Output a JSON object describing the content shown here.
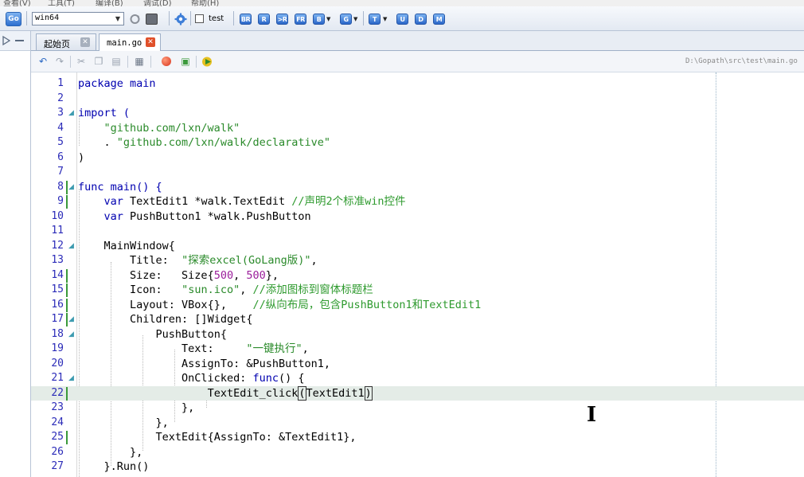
{
  "menubar": {
    "items": [
      "查看(V)",
      "工具(T)",
      "编译(B)",
      "调试(D)",
      "帮助(H)"
    ]
  },
  "toolbar": {
    "go_label": "Go",
    "target_select": "win64",
    "test_checkbox": {
      "label": "test",
      "checked": false
    },
    "buttons": [
      {
        "label": "BR"
      },
      {
        "label": "R"
      },
      {
        "label": ">R"
      },
      {
        "label": "FR"
      },
      {
        "label": "B",
        "dropdown": true
      },
      {
        "label": "G",
        "dropdown": true
      },
      {
        "label": "T",
        "dropdown": true
      },
      {
        "label": "U"
      },
      {
        "label": "D"
      },
      {
        "label": "M"
      }
    ]
  },
  "tabs": [
    {
      "label": "起始页",
      "active": false
    },
    {
      "label": "main.go",
      "active": true
    }
  ],
  "editor": {
    "file_path": "D:\\Gopath\\src\\test\\main.go",
    "current_line": 22,
    "lines": [
      {
        "n": "1"
      },
      {
        "n": "2"
      },
      {
        "n": "3"
      },
      {
        "n": "4"
      },
      {
        "n": "5"
      },
      {
        "n": "6"
      },
      {
        "n": "7"
      },
      {
        "n": "8"
      },
      {
        "n": "9"
      },
      {
        "n": "10"
      },
      {
        "n": "11"
      },
      {
        "n": "12"
      },
      {
        "n": "13"
      },
      {
        "n": "14"
      },
      {
        "n": "15"
      },
      {
        "n": "16"
      },
      {
        "n": "17"
      },
      {
        "n": "18"
      },
      {
        "n": "19"
      },
      {
        "n": "20"
      },
      {
        "n": "21"
      },
      {
        "n": "22"
      },
      {
        "n": "23"
      },
      {
        "n": "24"
      },
      {
        "n": "25"
      },
      {
        "n": "26"
      },
      {
        "n": "27"
      }
    ],
    "code": {
      "l1": "package main",
      "l3": "import (",
      "l4": "\"github.com/lxn/walk\"",
      "l5": "\"github.com/lxn/walk/declarative\"",
      "l7": ")",
      "l8": "func main() {",
      "l9_kw": "var",
      "l9_rest": "TextEdit1 *walk.TextEdit ",
      "l9_cmt": "//声明2个标准win控件",
      "l10_kw": "var",
      "l10_rest": "PushButton1 *walk.PushButton",
      "l12": "MainWindow{",
      "l13_key": "Title:  ",
      "l13_str": "\"探索excel(GoLang版)\"",
      "l14_key": "Size:   Size{",
      "l14_a": "500",
      "l14_b": "500",
      "l15_key": "Icon:   ",
      "l15_str": "\"sun.ico\"",
      "l15_cmt": "//添加图标到窗体标题栏",
      "l16_key": "Layout: VBox{},    ",
      "l16_cmt": "//纵向布局，包含PushButton1和TextEdit1",
      "l17": "Children: []Widget{",
      "l18": "PushButton{",
      "l19_key": "Text:     ",
      "l19_str": "\"一键执行\"",
      "l20": "AssignTo: &PushButton1,",
      "l21_key": "OnClicked: ",
      "l21_kw": "func",
      "l21_rest": "() {",
      "l22_a": "TextEdit_click",
      "l22_b": "TextEdit1",
      "l23": "},",
      "l24": "},",
      "l25": "TextEdit{AssignTo: &TextEdit1},",
      "l26": "},",
      "l27": "}.Run()"
    }
  },
  "colors": {
    "keyword": "#0000b0",
    "string": "#2a8a2a",
    "comment": "#2e9a2e",
    "number": "#9b1e9b",
    "line_number": "#2b2bb8",
    "change_marker": "#3a9a3a",
    "current_line_bg": "#e4ece7"
  }
}
